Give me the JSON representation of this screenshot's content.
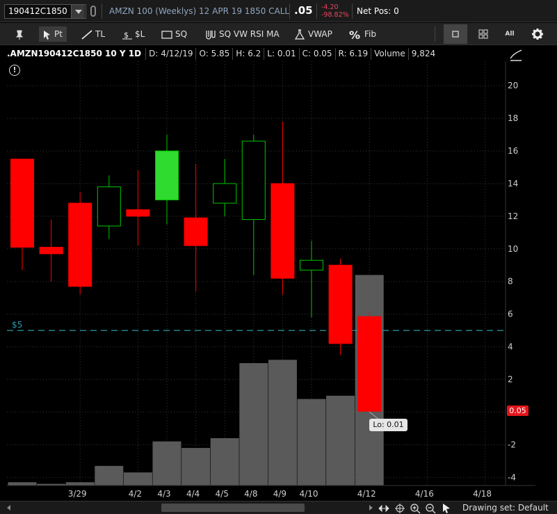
{
  "header": {
    "symbol": "190412C1850",
    "description": "AMZN 100 (Weeklys) 12 APR 19 1850 CALL",
    "last": ".05",
    "change": "-4.20",
    "change_pct": "-98.82%",
    "net_pos": "Net Pos: 0"
  },
  "toolbar": {
    "tools": [
      {
        "name": "pin",
        "label": ""
      },
      {
        "name": "pointer",
        "label": "Pt"
      },
      {
        "name": "trendline",
        "label": "TL"
      },
      {
        "name": "price-level",
        "label": "$L"
      },
      {
        "name": "square",
        "label": "SQ"
      },
      {
        "name": "studies",
        "label": "SQ VW RSI MA"
      },
      {
        "name": "vwap",
        "label": "VWAP"
      },
      {
        "name": "fib",
        "label": "Fib"
      }
    ],
    "right_icons": [
      "single-layout-icon",
      "grid-layout-icon",
      "all-label-icon",
      "gear-icon"
    ],
    "all_label": "All"
  },
  "info": {
    "symbol": ".AMZN190412C1850 10 Y 1D",
    "d_label": "D:",
    "d": "4/12/19",
    "o_label": "O:",
    "o": "5.85",
    "h_label": "H:",
    "h": "6.2",
    "l_label": "L:",
    "l": "0.01",
    "c_label": "C:",
    "c": "0.05",
    "r_label": "R:",
    "r": "6.19",
    "volume_label": "Volume",
    "volume": "9,824"
  },
  "chart_data": {
    "type": "candlestick",
    "title": ".AMZN190412C1850 10 Y 1D",
    "ylim": [
      -4.5,
      21.5
    ],
    "y_ticks": [
      -4,
      -2,
      0,
      2,
      4,
      6,
      8,
      10,
      12,
      14,
      16,
      18,
      20
    ],
    "x_tick_labels": [
      {
        "i": 2,
        "label": "3/29"
      },
      {
        "i": 4,
        "label": "4/2"
      },
      {
        "i": 5,
        "label": "4/3"
      },
      {
        "i": 6,
        "label": "4/4"
      },
      {
        "i": 7,
        "label": "4/5"
      },
      {
        "i": 8,
        "label": "4/8"
      },
      {
        "i": 9,
        "label": "4/9"
      },
      {
        "i": 10,
        "label": "4/10"
      },
      {
        "i": 12,
        "label": "4/12"
      },
      {
        "i": 14,
        "label": "4/16"
      },
      {
        "i": 16,
        "label": "4/18"
      }
    ],
    "candles": [
      {
        "i": 0,
        "o": 15.5,
        "h": 15.5,
        "l": 8.7,
        "c": 10.1
      },
      {
        "i": 1,
        "o": 10.1,
        "h": 11.8,
        "l": 8.0,
        "c": 9.7
      },
      {
        "i": 2,
        "o": 12.8,
        "h": 13.5,
        "l": 7.2,
        "c": 7.7
      },
      {
        "i": 3,
        "o": 11.4,
        "h": 14.5,
        "l": 10.6,
        "c": 13.8
      },
      {
        "i": 4,
        "o": 12.4,
        "h": 14.8,
        "l": 10.2,
        "c": 12.0
      },
      {
        "i": 5,
        "o": 13.0,
        "h": 17.0,
        "l": 11.5,
        "c": 16.0
      },
      {
        "i": 6,
        "o": 11.9,
        "h": 15.2,
        "l": 7.4,
        "c": 10.2
      },
      {
        "i": 7,
        "o": 12.8,
        "h": 15.5,
        "l": 12.0,
        "c": 14.0
      },
      {
        "i": 8,
        "o": 11.8,
        "h": 17.0,
        "l": 8.4,
        "c": 16.6
      },
      {
        "i": 9,
        "o": 14.0,
        "h": 17.8,
        "l": 7.2,
        "c": 8.2
      },
      {
        "i": 10,
        "o": 8.7,
        "h": 10.5,
        "l": 5.8,
        "c": 9.3
      },
      {
        "i": 11,
        "o": 9.0,
        "h": 9.4,
        "l": 3.5,
        "c": 4.2
      },
      {
        "i": 12,
        "o": 5.85,
        "h": 6.2,
        "l": 0.01,
        "c": 0.05
      }
    ],
    "volume": {
      "axis_base": -4.5,
      "values": [
        -4.3,
        -4.4,
        -4.3,
        -3.3,
        -3.7,
        -1.8,
        -2.2,
        -1.6,
        3.0,
        3.2,
        0.8,
        1.0,
        8.4
      ]
    },
    "price_level": {
      "value": 5,
      "label": "$5"
    },
    "last_price_badge": "0.05",
    "low_tooltip": "Lo: 0.01",
    "colors": {
      "up": "#00c800",
      "up_fill": "#2edb2e",
      "down": "#ff0000",
      "volume": "#5a5a5a",
      "grid": "#3a3a3a",
      "level": "#2a9ca6"
    }
  },
  "bottom": {
    "drawing_set": "Drawing set: Default"
  }
}
